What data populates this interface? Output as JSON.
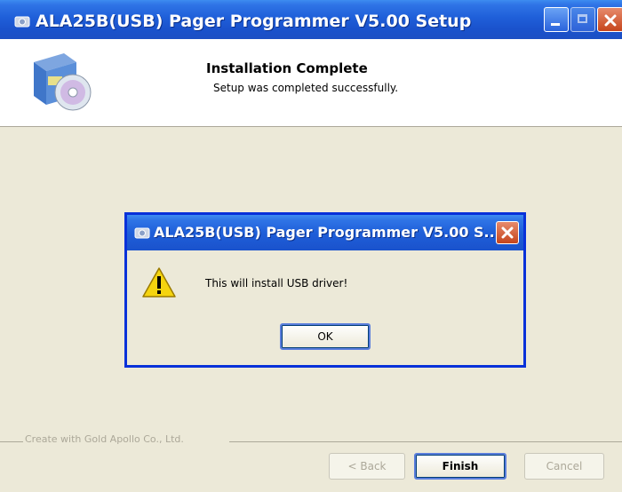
{
  "window": {
    "title": "ALA25B(USB) Pager Programmer V5.00 Setup",
    "controls": [
      "minimize",
      "maximize",
      "close"
    ]
  },
  "header": {
    "title": "Installation Complete",
    "subtitle": "Setup was completed successfully.",
    "icon": "setup-cd-box-icon"
  },
  "footer": {
    "branding": "Create with Gold Apollo Co., Ltd.",
    "back_label": "< Back",
    "finish_label": "Finish",
    "cancel_label": "Cancel"
  },
  "dialog": {
    "title": "ALA25B(USB) Pager Programmer V5.00 S...",
    "message": "This will install USB driver!",
    "ok_label": "OK",
    "icon": "warning-icon"
  },
  "colors": {
    "titlebar": "#2458d6",
    "face": "#ece9d8",
    "close": "#d45a31"
  }
}
